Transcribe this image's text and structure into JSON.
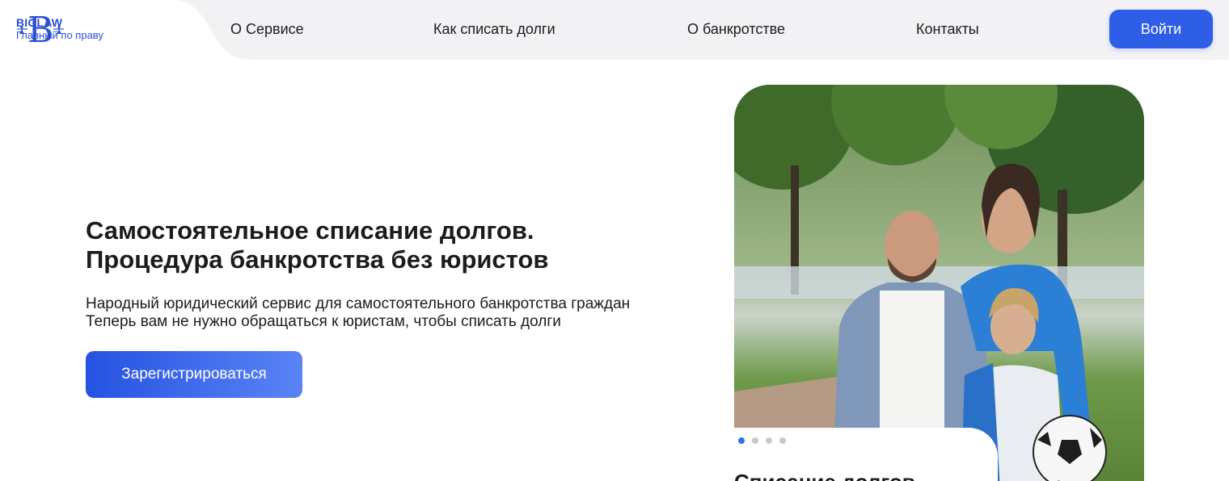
{
  "header": {
    "brand": {
      "name": "BIGLAW",
      "tagline": "Главный по праву",
      "logo_icon": "biglaw-scales-logo"
    },
    "nav": [
      {
        "label": "О Сервисе"
      },
      {
        "label": "Как списать долги"
      },
      {
        "label": "О банкротстве"
      },
      {
        "label": "Контакты"
      }
    ],
    "login_label": "Войти"
  },
  "hero": {
    "title_lines": [
      "Самостоятельное списание долгов.",
      "Процедура банкротства без юристов"
    ],
    "subtitle_lines": [
      "Народный юридический сервис для самостоятельного банкротства граждан",
      "Теперь вам не нужно обращаться к юристам, чтобы списать долги"
    ],
    "register_label": "Зарегистрироваться"
  },
  "slider": {
    "active_index": 0,
    "slide_count": 4,
    "caption": "Списание долгов"
  },
  "colors": {
    "accent": "#2f5ee6",
    "brand": "#2a4fd6",
    "dot_active": "#2f6fe6",
    "dot_inactive": "#c9c9cd"
  }
}
